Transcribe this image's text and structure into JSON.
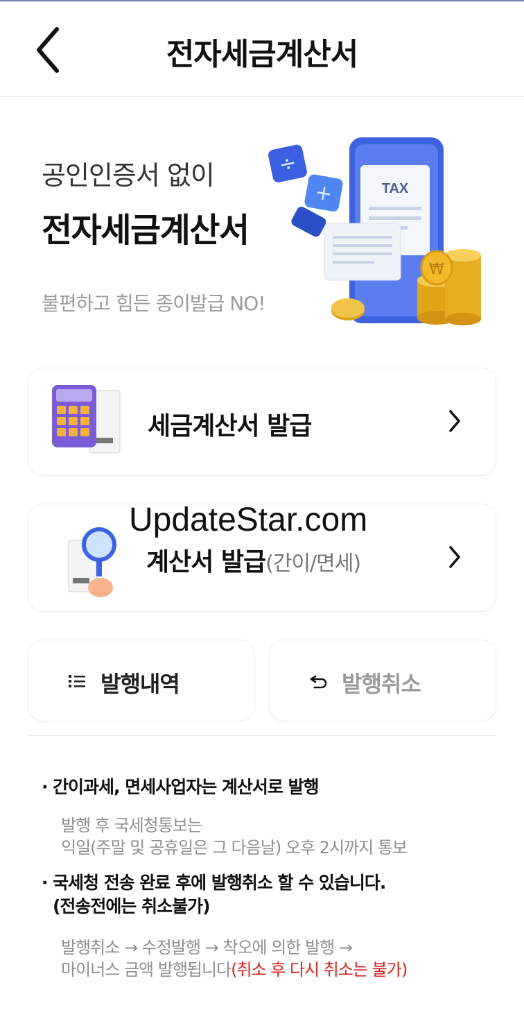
{
  "header": {
    "title": "전자세금계산서"
  },
  "hero": {
    "subtitle": "공인인증서 없이",
    "title": "전자세금계산서",
    "tagline": "불편하고 힘든 종이발급 NO!",
    "art_text": "TAX"
  },
  "menu": {
    "issue_tax_invoice": "세금계산서 발급",
    "issue_invoice": "계산서 발급",
    "issue_invoice_aux": "(간이/면세)",
    "history": "발행내역",
    "cancel": "발행취소"
  },
  "watermark": "UpdateStar.com",
  "notes": {
    "item1_title": "간이과세, 면세사업자는 계산서로 발행",
    "item1_line1": "발행 후 국세청통보는",
    "item1_line2": "익일(주말 및 공휴일은 그 다음날) 오후 2시까지 통보",
    "item2_title_line1": "국세청 전송 완료 후에 발행취소 할 수 있습니다.",
    "item2_title_line2": "(전송전에는 취소불가)",
    "item2_line1": "발행취소 → 수정발행 → 착오에 의한 발행 →",
    "item2_line2": "마이너스 금액 발행됩니다",
    "item2_warning": "(취소 후 다시 취소는 불가)"
  },
  "colors": {
    "warning": "#d9221d",
    "muted": "#8f8f8f",
    "accent_blue": "#3f63e0",
    "coin_gold": "#f2b92b"
  }
}
